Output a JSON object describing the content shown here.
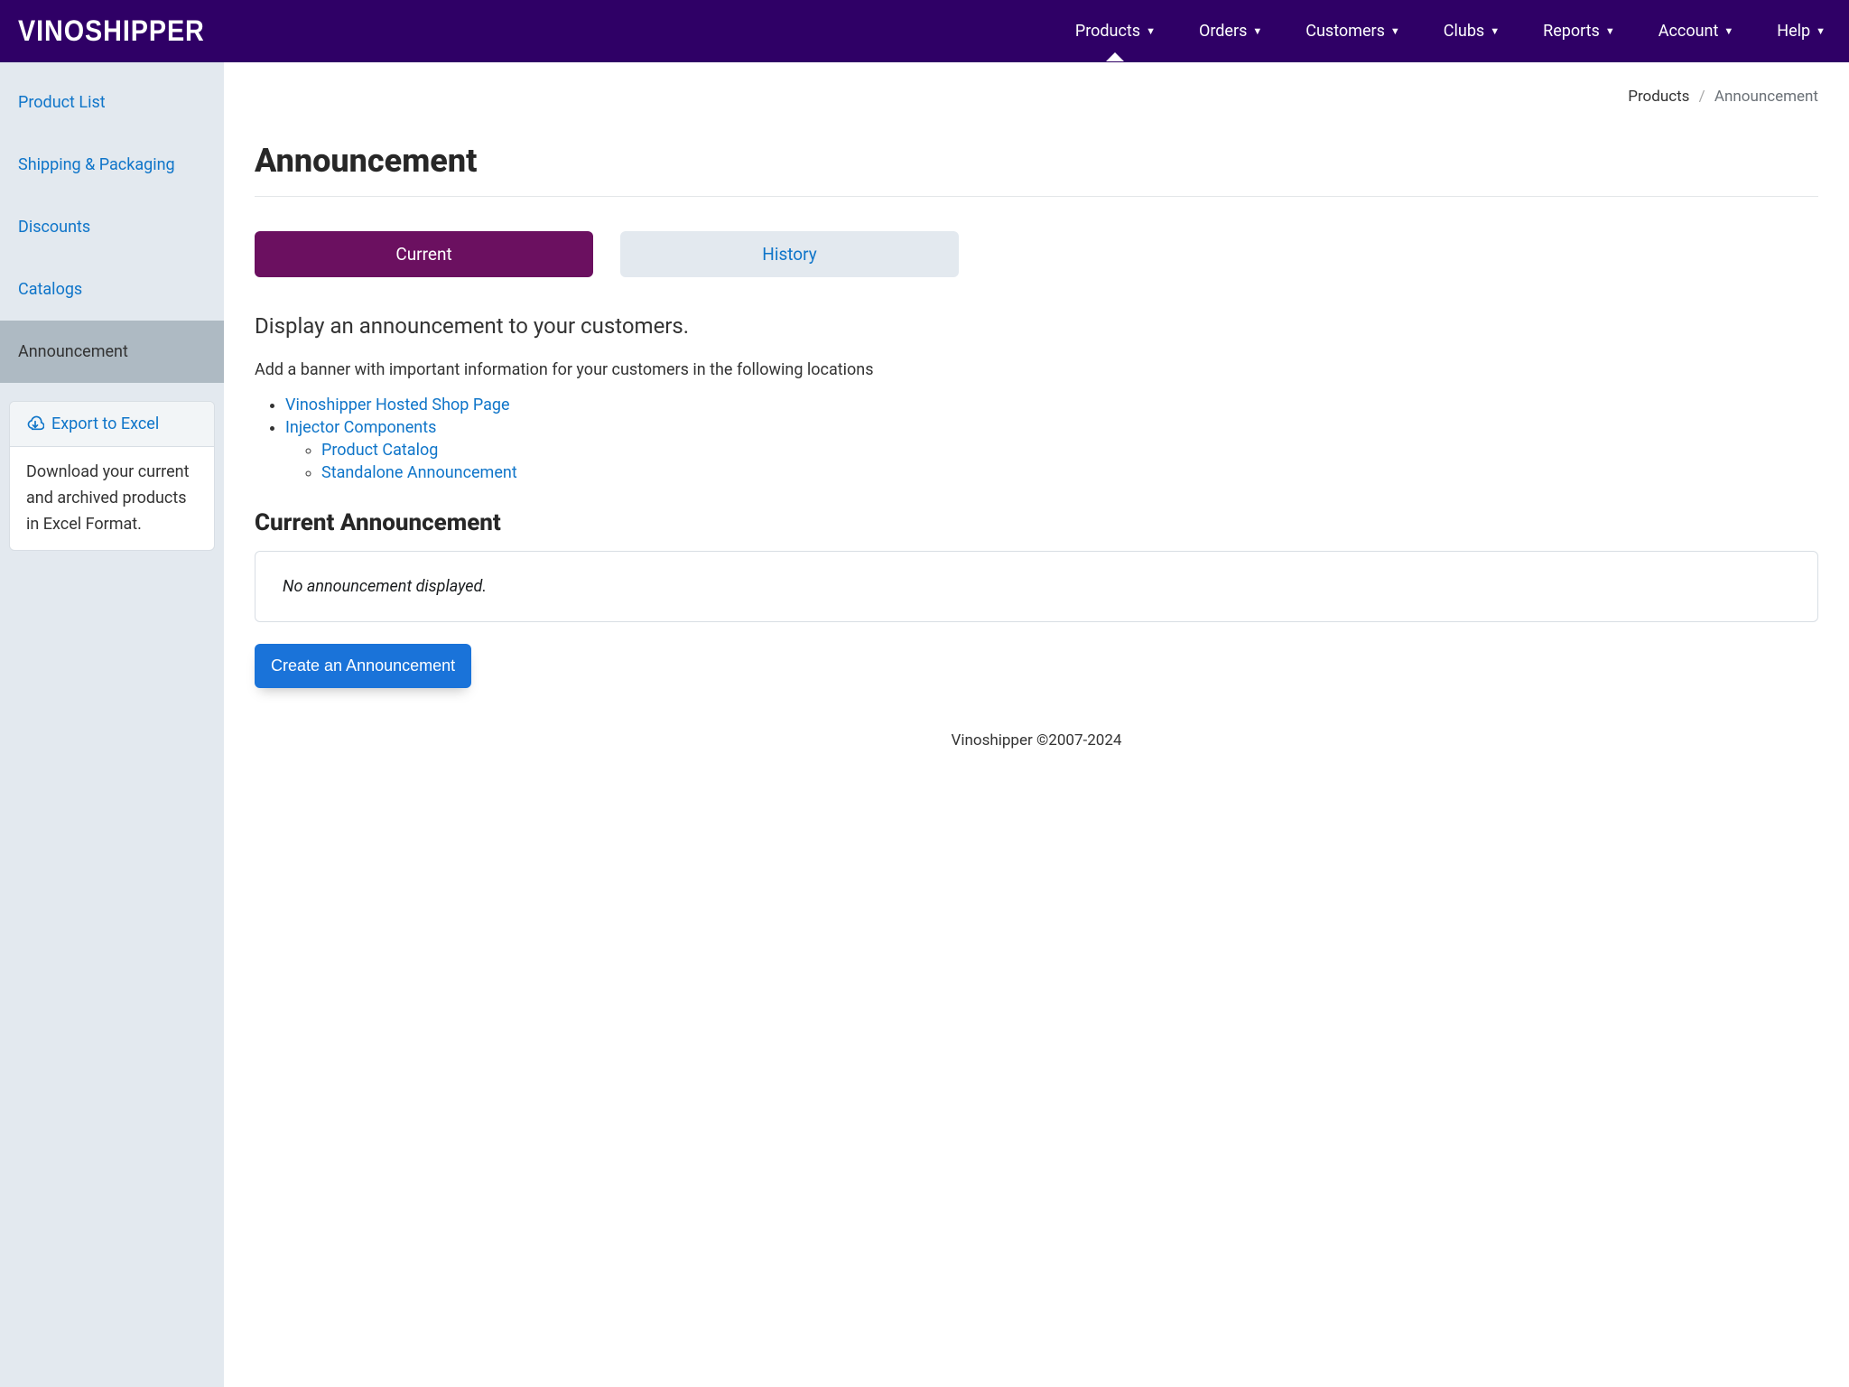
{
  "brand": "VINOSHIPPER",
  "nav": {
    "items": [
      {
        "label": "Products",
        "active": true
      },
      {
        "label": "Orders"
      },
      {
        "label": "Customers"
      },
      {
        "label": "Clubs"
      },
      {
        "label": "Reports"
      },
      {
        "label": "Account"
      },
      {
        "label": "Help"
      }
    ]
  },
  "sidebar": {
    "items": [
      {
        "label": "Product List"
      },
      {
        "label": "Shipping & Packaging"
      },
      {
        "label": "Discounts"
      },
      {
        "label": "Catalogs"
      },
      {
        "label": "Announcement",
        "active": true
      }
    ],
    "export": {
      "label": "Export to Excel",
      "desc": "Download your current and archived products in Excel Format."
    }
  },
  "breadcrumb": {
    "root": "Products",
    "current": "Announcement"
  },
  "page": {
    "title": "Announcement",
    "tabs": {
      "current": "Current",
      "history": "History"
    },
    "lead": "Display an announcement to your customers.",
    "para": "Add a banner with important information for your customers in the following locations",
    "links": {
      "shop": "Vinoshipper Hosted Shop Page",
      "injector": "Injector Components",
      "catalog": "Product Catalog",
      "standalone": "Standalone Announcement"
    },
    "section_heading": "Current Announcement",
    "empty": "No announcement displayed.",
    "create_btn": "Create an Announcement"
  },
  "footer": "Vinoshipper ©2007-2024"
}
